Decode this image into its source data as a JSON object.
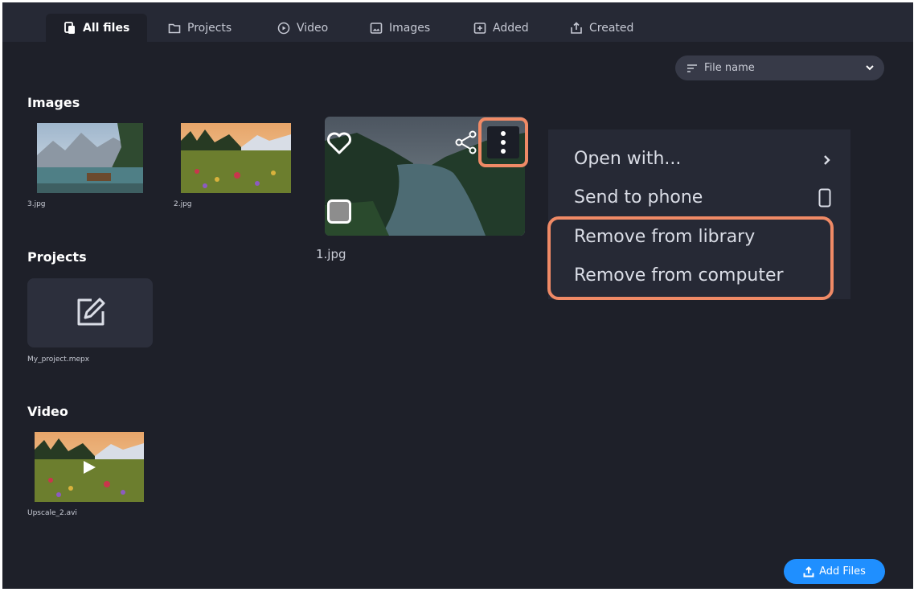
{
  "tabs": [
    {
      "label": "All files",
      "icon": "files-icon",
      "active": true
    },
    {
      "label": "Projects",
      "icon": "folder-icon",
      "active": false
    },
    {
      "label": "Video",
      "icon": "play-circle-icon",
      "active": false
    },
    {
      "label": "Images",
      "icon": "image-icon",
      "active": false
    },
    {
      "label": "Added",
      "icon": "add-box-icon",
      "active": false
    },
    {
      "label": "Created",
      "icon": "export-icon",
      "active": false
    }
  ],
  "sort": {
    "label": "File name"
  },
  "sections": {
    "images": {
      "title": "Images",
      "items": [
        {
          "name": "3.jpg"
        },
        {
          "name": "2.jpg"
        },
        {
          "name": "1.jpg"
        }
      ]
    },
    "projects": {
      "title": "Projects",
      "items": [
        {
          "name": "My_project.mepx"
        }
      ]
    },
    "video": {
      "title": "Video",
      "items": [
        {
          "name": "Upscale_2.avi"
        }
      ]
    }
  },
  "context_menu": {
    "items": [
      {
        "label": "Open with..."
      },
      {
        "label": "Send to phone"
      },
      {
        "label": "Remove from library"
      },
      {
        "label": "Remove from computer"
      }
    ]
  },
  "add_files": {
    "label": "Add Files"
  },
  "colors": {
    "background": "#1e2029",
    "tab_bar": "#262935",
    "highlight": "#f08a66",
    "accent": "#1f8fff"
  }
}
